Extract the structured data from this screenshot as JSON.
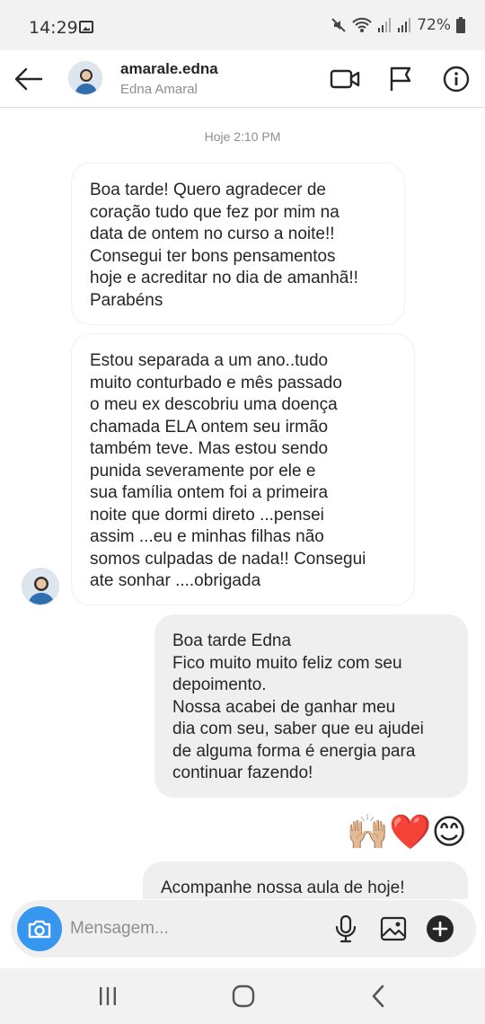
{
  "status_bar": {
    "time": "14:29",
    "battery": "72%"
  },
  "header": {
    "username": "amarale.edna",
    "full_name": "Edna Amaral"
  },
  "thread": {
    "timestamp": "Hoje 2:10 PM",
    "messages": [
      {
        "from": "them",
        "text": "Boa tarde! Quero agradecer de\ncoração tudo que fez por mim na\ndata de ontem no curso a noite!!\nConsegui ter bons pensamentos\nhoje e acreditar no dia de amanhã!!\nParabéns"
      },
      {
        "from": "them",
        "text": "Estou separada a um ano..tudo\nmuito conturbado e mês passado\no meu ex descobriu uma doença\nchamada ELA ontem seu irmão\ntambém teve. Mas estou sendo\npunida severamente por ele e\nsua família ontem foi a primeira\nnoite que dormi direto ...pensei\nassim ...eu e minhas filhas não\nsomos culpadas de nada!! Consegui\nate sonhar ....obrigada"
      },
      {
        "from": "me",
        "text": "Boa tarde Edna\nFico muito muito feliz com seu\ndepoimento.\nNossa acabei de ganhar meu\ndia com seu, saber que eu ajudei\nde alguma forma é energia para\ncontinuar fazendo!"
      },
      {
        "from": "me",
        "text": "🙌🏼❤️😊"
      },
      {
        "from": "me",
        "text": "Acompanhe nossa aula de hoje!"
      }
    ]
  },
  "composer": {
    "placeholder": "Mensagem..."
  },
  "colors": {
    "accent": "#3797f0",
    "bubble_out": "#efefef",
    "bubble_in_border": "#efefef",
    "heart": "#e0141e"
  },
  "icons": [
    "back-arrow-icon",
    "video-call-icon",
    "flag-icon",
    "info-icon",
    "camera-icon",
    "microphone-icon",
    "gallery-icon",
    "add-icon",
    "recents-icon",
    "home-icon",
    "back-icon"
  ]
}
